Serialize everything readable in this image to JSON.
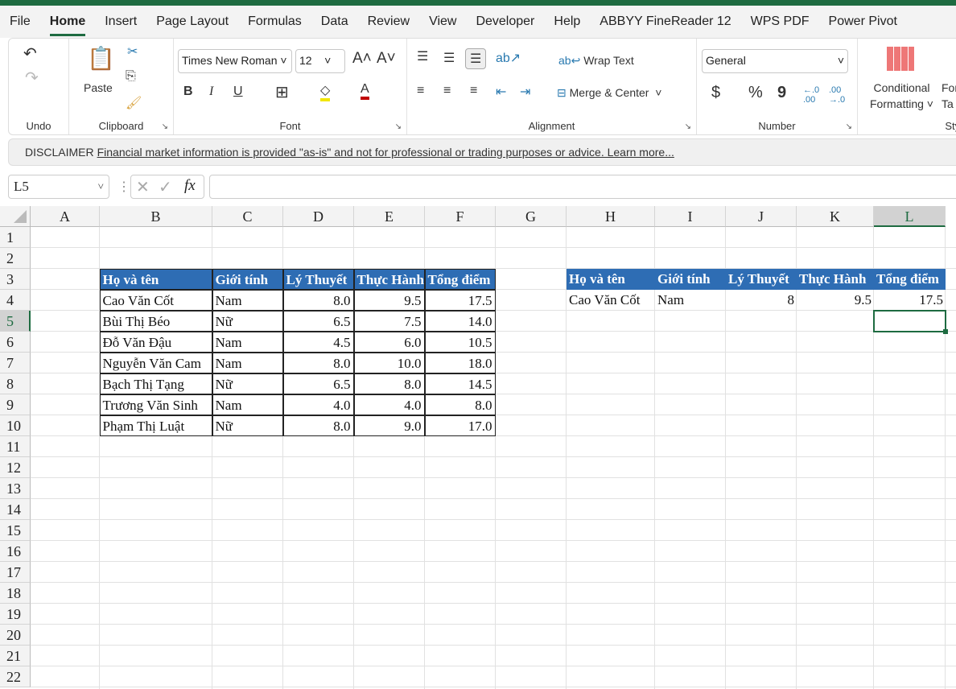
{
  "menu_tabs": [
    "File",
    "Home",
    "Insert",
    "Page Layout",
    "Formulas",
    "Data",
    "Review",
    "View",
    "Developer",
    "Help",
    "ABBYY FineReader 12",
    "WPS PDF",
    "Power Pivot"
  ],
  "active_tab": "Home",
  "ribbon": {
    "undo_label": "Undo",
    "clipboard_label": "Clipboard",
    "paste_label": "Paste",
    "font_label": "Font",
    "font_name": "Times New Roman",
    "font_size": "12",
    "bold": "B",
    "italic": "I",
    "underline": "U",
    "alignment_label": "Alignment",
    "wrap_text": "Wrap Text",
    "merge_center": "Merge & Center",
    "number_label": "Number",
    "number_format": "General",
    "currency": "$",
    "percent": "%",
    "comma": "9",
    "conditional_1": "Conditional",
    "conditional_2": "Formatting",
    "format_1": "For",
    "format_2": "Ta",
    "styles_label": "Styl"
  },
  "disclaimer": {
    "label": "DISCLAIMER",
    "text": "Financial market information is provided \"as-is\" and not for professional or trading purposes or advice. Learn more..."
  },
  "formula_bar": {
    "name_box": "L5",
    "fx": "fx",
    "value": ""
  },
  "columns": [
    "A",
    "B",
    "C",
    "D",
    "E",
    "F",
    "G",
    "H",
    "I",
    "J",
    "K",
    "L"
  ],
  "rows": [
    "1",
    "2",
    "3",
    "4",
    "5",
    "6",
    "7",
    "8",
    "9",
    "10",
    "11",
    "12",
    "13",
    "14",
    "15",
    "16",
    "17",
    "18",
    "19",
    "20",
    "21",
    "22"
  ],
  "selected_cell": "L5",
  "table1": {
    "headers": [
      "Họ và tên",
      "Giới tính",
      "Lý Thuyết",
      "Thực Hành",
      "Tổng điểm"
    ],
    "rows": [
      [
        "Cao Văn Cốt",
        "Nam",
        "8.0",
        "9.5",
        "17.5"
      ],
      [
        "Bùi Thị Béo",
        "Nữ",
        "6.5",
        "7.5",
        "14.0"
      ],
      [
        "Đỗ Văn Đậu",
        "Nam",
        "4.5",
        "6.0",
        "10.5"
      ],
      [
        "Nguyễn Văn Cam",
        "Nam",
        "8.0",
        "10.0",
        "18.0"
      ],
      [
        "Bạch Thị Tạng",
        "Nữ",
        "6.5",
        "8.0",
        "14.5"
      ],
      [
        "Trương Văn Sinh",
        "Nam",
        "4.0",
        "4.0",
        "8.0"
      ],
      [
        "Phạm Thị Luật",
        "Nữ",
        "8.0",
        "9.0",
        "17.0"
      ]
    ]
  },
  "table2": {
    "headers": [
      "Họ và tên",
      "Giới tính",
      "Lý Thuyết",
      "Thực Hành",
      "Tổng điểm"
    ],
    "rows": [
      [
        "Cao Văn Cốt",
        "Nam",
        "8",
        "9.5",
        "17.5"
      ]
    ]
  },
  "colors": {
    "header_fill": "#2e6db4",
    "accent": "#1e6b41"
  }
}
